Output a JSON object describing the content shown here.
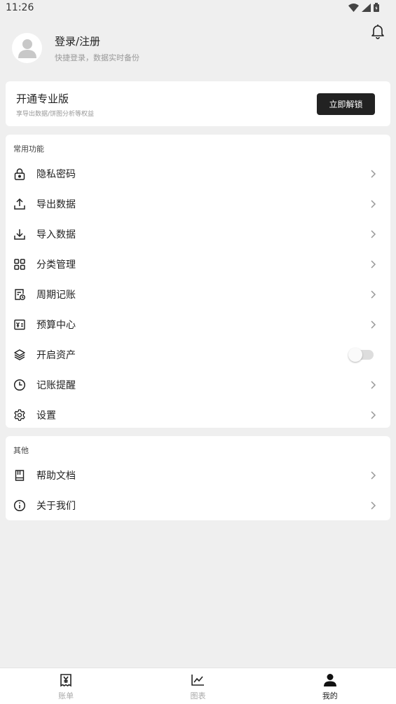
{
  "status_bar": {
    "time": "11:26"
  },
  "profile": {
    "title": "登录/注册",
    "subtitle": "快捷登录，数据实时备份"
  },
  "pro": {
    "title": "开通专业版",
    "subtitle": "享导出数据/饼图分析等权益",
    "button": "立即解锁"
  },
  "common": {
    "section_title": "常用功能",
    "items": [
      {
        "label": "隐私密码",
        "icon": "lock-icon"
      },
      {
        "label": "导出数据",
        "icon": "upload-icon"
      },
      {
        "label": "导入数据",
        "icon": "download-icon"
      },
      {
        "label": "分类管理",
        "icon": "grid-icon"
      },
      {
        "label": "周期记账",
        "icon": "recurring-icon"
      },
      {
        "label": "预算中心",
        "icon": "budget-icon"
      },
      {
        "label": "开启资产",
        "icon": "layers-icon",
        "toggle": false
      },
      {
        "label": "记账提醒",
        "icon": "clock-icon"
      },
      {
        "label": "设置",
        "icon": "gear-icon"
      }
    ]
  },
  "other": {
    "section_title": "其他",
    "items": [
      {
        "label": "帮助文档",
        "icon": "book-icon"
      },
      {
        "label": "关于我们",
        "icon": "info-icon"
      }
    ]
  },
  "nav": {
    "items": [
      {
        "label": "账单",
        "icon": "bill-icon",
        "active": false
      },
      {
        "label": "图表",
        "icon": "chart-icon",
        "active": false
      },
      {
        "label": "我的",
        "icon": "person-icon",
        "active": true
      }
    ]
  }
}
